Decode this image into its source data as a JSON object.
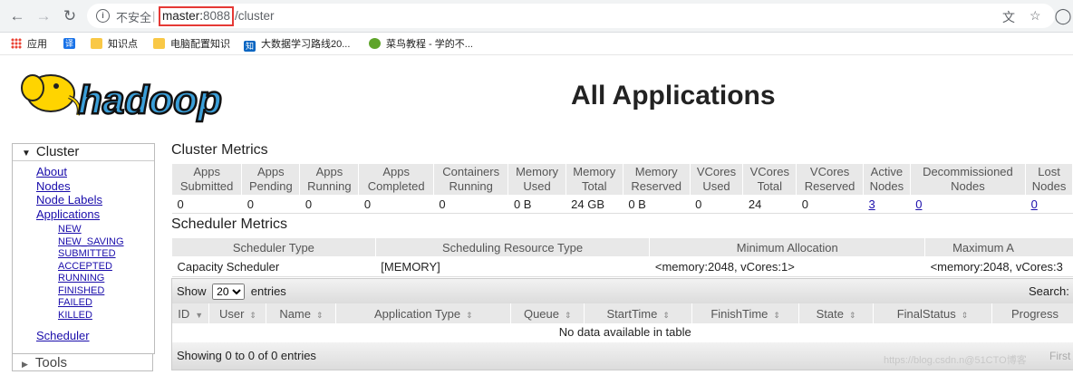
{
  "browser": {
    "insecure_label": "不安全",
    "url_host": "master:",
    "url_port": "8088",
    "url_path": "/cluster"
  },
  "bookmarks": [
    {
      "label": "应用",
      "icon": "apps-grid-icon",
      "color": "#ea4335"
    },
    {
      "label": "",
      "icon": "translate-icon",
      "color": "#1a73e8"
    },
    {
      "label": "知识点",
      "icon": "folder-icon",
      "color": "#f9c846"
    },
    {
      "label": "电脑配置知识",
      "icon": "folder-icon",
      "color": "#f9c846"
    },
    {
      "label": "大数据学习路线20...",
      "icon": "zhihu-icon",
      "color": "#0a66c2"
    },
    {
      "label": "菜鸟教程 - 学的不...",
      "icon": "runoob-icon",
      "color": "#5fa42a"
    }
  ],
  "page": {
    "logo_text": "hadoop",
    "title": "All Applications"
  },
  "sidebar": {
    "cluster_label": "Cluster",
    "links": [
      "About",
      "Nodes",
      "Node Labels",
      "Applications"
    ],
    "states": [
      "NEW",
      "NEW_SAVING",
      "SUBMITTED",
      "ACCEPTED",
      "RUNNING",
      "FINISHED",
      "FAILED",
      "KILLED"
    ],
    "scheduler_label": "Scheduler",
    "tools_label": "Tools"
  },
  "cluster_metrics": {
    "title": "Cluster Metrics",
    "headers": [
      [
        "Apps",
        "Submitted"
      ],
      [
        "Apps",
        "Pending"
      ],
      [
        "Apps",
        "Running"
      ],
      [
        "Apps",
        "Completed"
      ],
      [
        "Containers",
        "Running"
      ],
      [
        "Memory",
        "Used"
      ],
      [
        "Memory",
        "Total"
      ],
      [
        "Memory",
        "Reserved"
      ],
      [
        "VCores",
        "Used"
      ],
      [
        "VCores",
        "Total"
      ],
      [
        "VCores",
        "Reserved"
      ],
      [
        "Active",
        "Nodes"
      ],
      [
        "Decommissioned",
        "Nodes"
      ],
      [
        "Lost",
        "Nodes"
      ]
    ],
    "values": [
      "0",
      "0",
      "0",
      "0",
      "0",
      "0 B",
      "24 GB",
      "0 B",
      "0",
      "24",
      "0",
      "3",
      "0",
      "0"
    ]
  },
  "scheduler_metrics": {
    "title": "Scheduler Metrics",
    "headers": [
      "Scheduler Type",
      "Scheduling Resource Type",
      "Minimum Allocation",
      "Maximum A"
    ],
    "row": [
      "Capacity Scheduler",
      "[MEMORY]",
      "<memory:2048, vCores:1>",
      "<memory:2048, vCores:3"
    ]
  },
  "apps_table": {
    "show_label": "Show",
    "page_size": "20",
    "entries_label": "entries",
    "search_label": "Search:",
    "columns": [
      "ID",
      "User",
      "Name",
      "Application Type",
      "Queue",
      "StartTime",
      "FinishTime",
      "State",
      "FinalStatus",
      "Progress"
    ],
    "empty_message": "No data available in table",
    "footer": "Showing 0 to 0 of 0 entries",
    "first_label": "First"
  },
  "watermark": "https://blog.csdn.n@51CTO博客"
}
